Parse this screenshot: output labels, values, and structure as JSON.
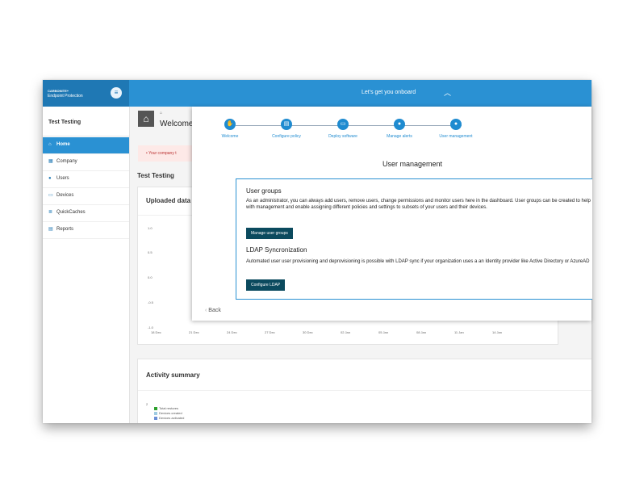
{
  "app": {
    "brand_line1": "CARBONITE+",
    "brand_line2": "Endpoint Protection",
    "menu_icon": "hamburger-icon",
    "onboard_text": "Let's get you onboard",
    "collapse_icon": "chevron-up-icon"
  },
  "sidebar": {
    "org_name": "Test Testing",
    "items": [
      {
        "label": "Home",
        "icon": "home-icon",
        "active": true
      },
      {
        "label": "Company",
        "icon": "building-icon"
      },
      {
        "label": "Users",
        "icon": "users-icon"
      },
      {
        "label": "Devices",
        "icon": "laptop-icon"
      },
      {
        "label": "QuickCaches",
        "icon": "database-icon"
      },
      {
        "label": "Reports",
        "icon": "report-icon"
      }
    ]
  },
  "main": {
    "breadcrumb": "⌂",
    "page_title": "Welcome",
    "alert_text": "Your company t",
    "section_title": "Test Testing",
    "uploaded_card_title": "Uploaded data",
    "y_ticks": [
      "1.0",
      "0.5",
      "0.0",
      "-0.5",
      "-1.0"
    ],
    "x_ticks": [
      "18 Dec",
      "21 Dec",
      "24 Dec",
      "27 Dec",
      "30 Dec",
      "02 Jan",
      "05 Jan",
      "08 Jan",
      "11 Jan",
      "14 Jan"
    ],
    "activity_title": "Activity summary",
    "activity_y_top": "2",
    "legend": [
      {
        "label": "Total restores",
        "color": "#2ca02c"
      },
      {
        "label": "Devices created",
        "color": "#9ecae1"
      },
      {
        "label": "Devices activated",
        "color": "#6b8fd6"
      }
    ]
  },
  "onboarding": {
    "steps": [
      {
        "label": "Welcome",
        "icon": "hand-icon"
      },
      {
        "label": "Configure policy",
        "icon": "document-icon"
      },
      {
        "label": "Deploy software",
        "icon": "monitor-icon"
      },
      {
        "label": "Manage alerts",
        "icon": "bell-icon"
      },
      {
        "label": "User management",
        "icon": "users-icon"
      }
    ],
    "title": "User management",
    "groups_heading": "User groups",
    "groups_text": "As an administrator,  you can always add users, remove users, change permissions and monitor users here in the dashboard. User groups can be created to help with management and enable assigning different policies and settings to subsets of your users and their devices.",
    "groups_button": "Manage user groups",
    "ldap_heading": "LDAP Syncronization",
    "ldap_text": "Automated user user provisioning and deprovisioning is possible with LDAP sync if your organization uses a an Identity provider like Active Directory or AzureAD",
    "ldap_button": "Configure LDAP",
    "back_label": "Back",
    "back_icon": "chevron-left-icon"
  },
  "colors": {
    "topbar": "#2a91d3",
    "accent": "#1f8bd0",
    "button": "#0b4a5e"
  }
}
